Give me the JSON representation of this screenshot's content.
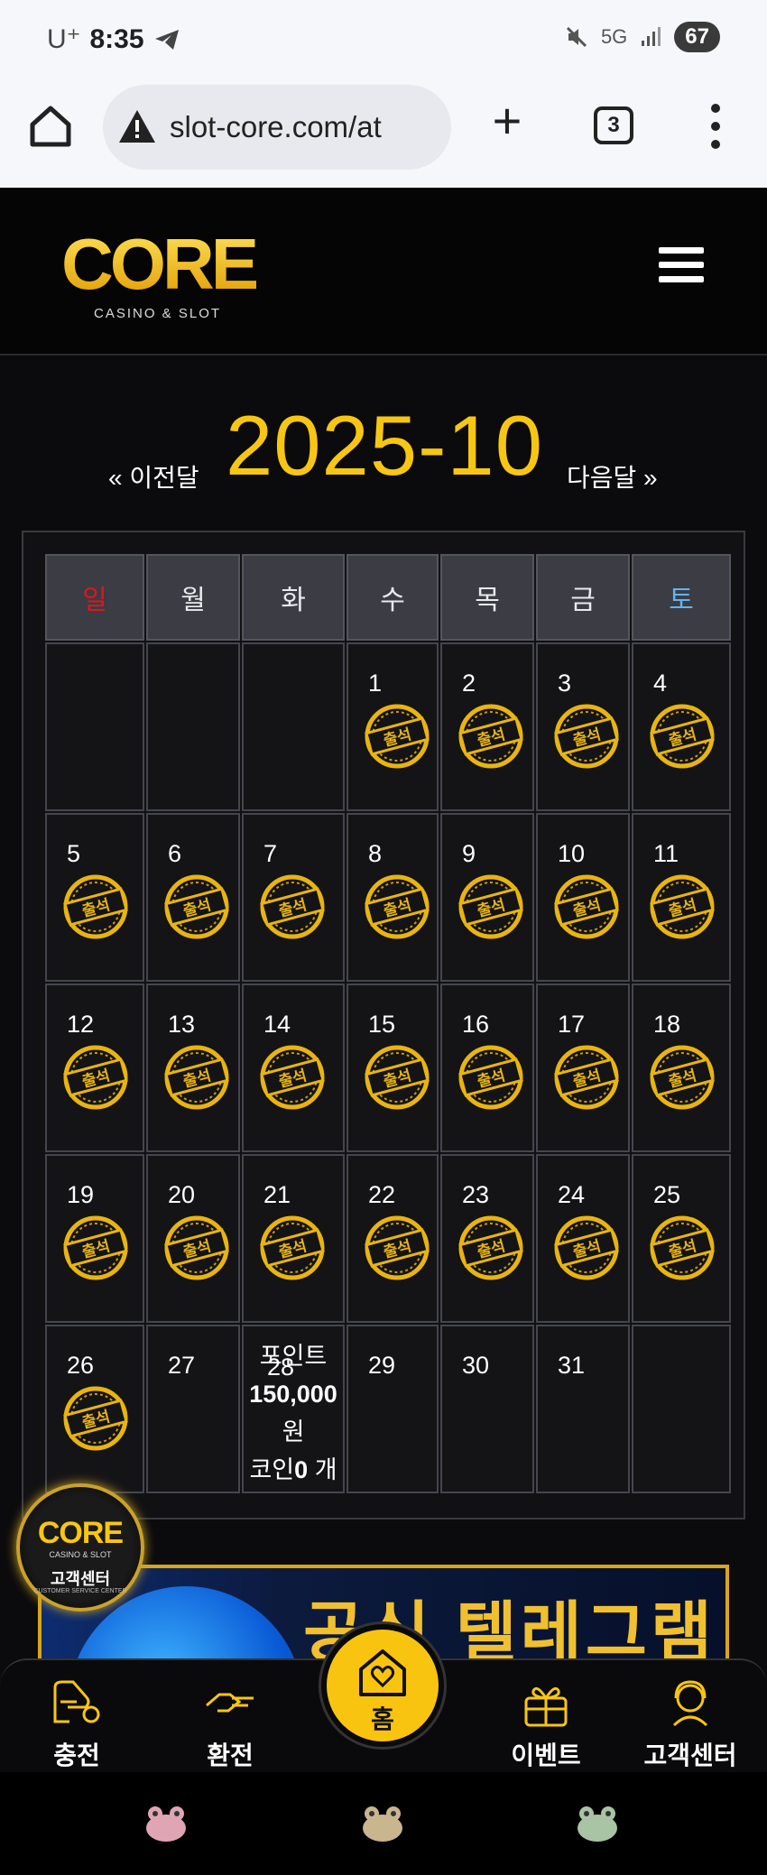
{
  "status_bar": {
    "carrier": "U⁺",
    "time": "8:35",
    "network": "5G",
    "battery": "67"
  },
  "browser": {
    "url": "slot-core.com/at",
    "tab_count": "3"
  },
  "site": {
    "logo_text": "CORE",
    "logo_sub": "CASINO & SLOT"
  },
  "calendar": {
    "prev_label": "« 이전달",
    "next_label": "다음달 »",
    "year_month": "2025-10",
    "weekdays": [
      "일",
      "월",
      "화",
      "수",
      "목",
      "금",
      "토"
    ],
    "days": [
      "1",
      "2",
      "3",
      "4",
      "5",
      "6",
      "7",
      "8",
      "9",
      "10",
      "11",
      "12",
      "13",
      "14",
      "15",
      "16",
      "17",
      "18",
      "19",
      "20",
      "21",
      "22",
      "23",
      "24",
      "25",
      "26",
      "27",
      "28",
      "29",
      "30",
      "31"
    ],
    "stamp_text": "출석",
    "points_label": "포인트",
    "points_value": "150,000",
    "points_unit": "원",
    "coin_label": "코인",
    "coin_value": "0",
    "coin_unit": " 개"
  },
  "badge": {
    "logo": "CORE",
    "sub": "CASINO & SLOT",
    "label": "고객센터",
    "sub2": "CUSTOMER SERVICE CENTER"
  },
  "banner": {
    "text": "공식 텔레그램"
  },
  "bottom_nav": {
    "deposit": "충전",
    "withdraw": "환전",
    "home": "홈",
    "event": "이벤트",
    "support": "고객센터"
  },
  "colors": {
    "accent": "#f7c613",
    "sunday": "#e2141c",
    "saturday": "#61b4f2"
  }
}
